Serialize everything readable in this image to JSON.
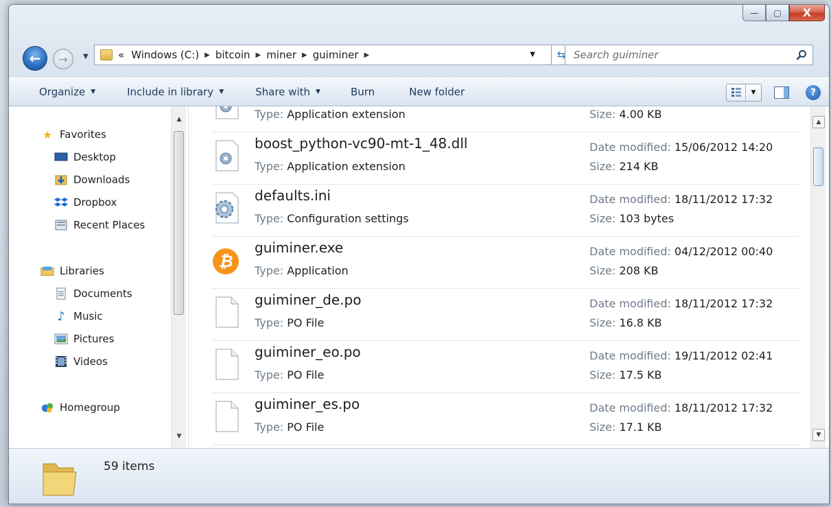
{
  "window": {
    "caption": {
      "min": "—",
      "max": "▢",
      "close": "X"
    }
  },
  "address": {
    "prefix": "«",
    "crumbs": [
      "Windows (C:)",
      "bitcoin",
      "miner",
      "guiminer"
    ],
    "search_placeholder": "Search guiminer"
  },
  "toolbar": {
    "organize": "Organize",
    "include_in_library": "Include in library",
    "share_with": "Share with",
    "burn": "Burn",
    "new_folder": "New folder"
  },
  "nav": {
    "favorites": "Favorites",
    "desktop": "Desktop",
    "downloads": "Downloads",
    "dropbox": "Dropbox",
    "recent_places": "Recent Places",
    "libraries": "Libraries",
    "documents": "Documents",
    "music": "Music",
    "pictures": "Pictures",
    "videos": "Videos",
    "homegroup": "Homegroup"
  },
  "labels": {
    "type": "Type:",
    "date_modified": "Date modified:",
    "size": "Size:"
  },
  "files": [
    {
      "name": "",
      "type": "Application extension",
      "date": "",
      "size": "4.00 KB",
      "icon": "dll-gear-icon"
    },
    {
      "name": "boost_python-vc90-mt-1_48.dll",
      "type": "Application extension",
      "date": "15/06/2012 14:20",
      "size": "214 KB",
      "icon": "dll-gear-icon"
    },
    {
      "name": "defaults.ini",
      "type": "Configuration settings",
      "date": "18/11/2012 17:32",
      "size": "103 bytes",
      "icon": "settings-gear-icon"
    },
    {
      "name": "guiminer.exe",
      "type": "Application",
      "date": "04/12/2012 00:40",
      "size": "208 KB",
      "icon": "bitcoin-icon"
    },
    {
      "name": "guiminer_de.po",
      "type": "PO File",
      "date": "18/11/2012 17:32",
      "size": "16.8 KB",
      "icon": "blank-file-icon"
    },
    {
      "name": "guiminer_eo.po",
      "type": "PO File",
      "date": "19/11/2012 02:41",
      "size": "17.5 KB",
      "icon": "blank-file-icon"
    },
    {
      "name": "guiminer_es.po",
      "type": "PO File",
      "date": "18/11/2012 17:32",
      "size": "17.1 KB",
      "icon": "blank-file-icon"
    }
  ],
  "status": {
    "items": "59 items"
  },
  "colors": {
    "accent": "#1e395b",
    "bitcoin": "#f7931a",
    "label_gray": "#6d7a88"
  }
}
